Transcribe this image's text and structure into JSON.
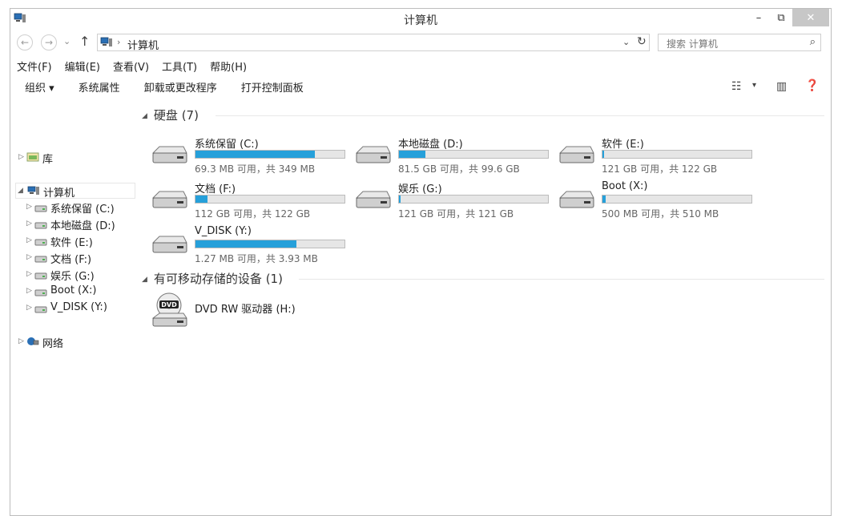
{
  "window": {
    "title": "计算机"
  },
  "title_buttons": {
    "minimize": "–",
    "maximize": "⧉",
    "close": "✕"
  },
  "address": {
    "path": "计算机",
    "search_placeholder": "搜索 计算机"
  },
  "menu": [
    "文件(F)",
    "编辑(E)",
    "查看(V)",
    "工具(T)",
    "帮助(H)"
  ],
  "commands": [
    "组织 ▾",
    "系统属性",
    "卸载或更改程序",
    "打开控制面板"
  ],
  "nav_tree": {
    "library": "库",
    "computer": "计算机",
    "drives": [
      "系统保留 (C:)",
      "本地磁盘 (D:)",
      "软件 (E:)",
      "文档 (F:)",
      "娱乐 (G:)",
      "Boot (X:)",
      "V_DISK (Y:)"
    ],
    "network": "网络"
  },
  "groups": {
    "hard_disks": {
      "label": "硬盘 (7)"
    },
    "removable": {
      "label": "有可移动存储的设备 (1)"
    }
  },
  "drives": [
    {
      "name": "系统保留 (C:)",
      "size_text": "69.3 MB 可用，共 349 MB",
      "used_fraction": 0.8
    },
    {
      "name": "本地磁盘 (D:)",
      "size_text": "81.5 GB 可用，共 99.6 GB",
      "used_fraction": 0.18
    },
    {
      "name": "软件 (E:)",
      "size_text": "121 GB 可用，共 122 GB",
      "used_fraction": 0.01
    },
    {
      "name": "文档 (F:)",
      "size_text": "112 GB 可用，共 122 GB",
      "used_fraction": 0.08
    },
    {
      "name": "娱乐 (G:)",
      "size_text": "121 GB 可用，共 121 GB",
      "used_fraction": 0.01
    },
    {
      "name": "Boot (X:)",
      "size_text": "500 MB 可用，共 510 MB",
      "used_fraction": 0.02
    },
    {
      "name": "V_DISK (Y:)",
      "size_text": "1.27 MB 可用，共 3.93 MB",
      "used_fraction": 0.68
    }
  ],
  "dvd": {
    "name": "DVD RW 驱动器 (H:)",
    "icon_label": "DVD"
  },
  "colors": {
    "bar_fill": "#26a0da",
    "bar_empty": "#e6e6e6"
  }
}
